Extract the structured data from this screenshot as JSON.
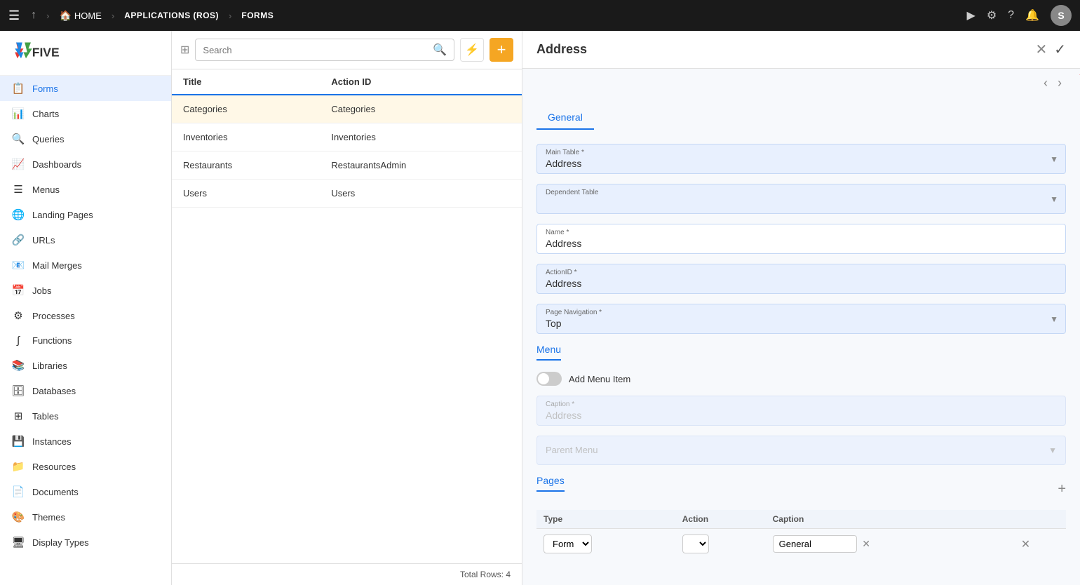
{
  "topNav": {
    "breadcrumbs": [
      "HOME",
      "APPLICATIONS (ROS)",
      "FORMS"
    ],
    "avatarInitial": "S"
  },
  "sidebar": {
    "logo": "FIVE",
    "items": [
      {
        "label": "Forms",
        "icon": "📋",
        "active": true
      },
      {
        "label": "Charts",
        "icon": "📊",
        "active": false
      },
      {
        "label": "Queries",
        "icon": "🔍",
        "active": false
      },
      {
        "label": "Dashboards",
        "icon": "📈",
        "active": false
      },
      {
        "label": "Menus",
        "icon": "☰",
        "active": false
      },
      {
        "label": "Landing Pages",
        "icon": "🌐",
        "active": false
      },
      {
        "label": "URLs",
        "icon": "🔗",
        "active": false
      },
      {
        "label": "Mail Merges",
        "icon": "📧",
        "active": false
      },
      {
        "label": "Jobs",
        "icon": "📅",
        "active": false
      },
      {
        "label": "Processes",
        "icon": "⚙",
        "active": false
      },
      {
        "label": "Functions",
        "icon": "∫",
        "active": false
      },
      {
        "label": "Libraries",
        "icon": "📚",
        "active": false
      },
      {
        "label": "Databases",
        "icon": "🗄",
        "active": false
      },
      {
        "label": "Tables",
        "icon": "⊞",
        "active": false
      },
      {
        "label": "Instances",
        "icon": "💾",
        "active": false
      },
      {
        "label": "Resources",
        "icon": "📁",
        "active": false
      },
      {
        "label": "Documents",
        "icon": "📄",
        "active": false
      },
      {
        "label": "Themes",
        "icon": "🎨",
        "active": false
      },
      {
        "label": "Display Types",
        "icon": "🖥",
        "active": false
      }
    ]
  },
  "listPanel": {
    "searchPlaceholder": "Search",
    "columns": [
      {
        "key": "title",
        "label": "Title"
      },
      {
        "key": "actionId",
        "label": "Action ID"
      }
    ],
    "rows": [
      {
        "title": "Categories",
        "actionId": "Categories",
        "selected": true
      },
      {
        "title": "Inventories",
        "actionId": "Inventories",
        "selected": false
      },
      {
        "title": "Restaurants",
        "actionId": "RestaurantsAdmin",
        "selected": false
      },
      {
        "title": "Users",
        "actionId": "Users",
        "selected": false
      }
    ],
    "footer": "Total Rows: 4"
  },
  "detailPanel": {
    "title": "Address",
    "tabs": [
      "General",
      "Menu",
      "Pages"
    ],
    "activeTab": "General",
    "general": {
      "mainTableLabel": "Main Table *",
      "mainTableValue": "Address",
      "dependentTableLabel": "Dependent Table",
      "dependentTableValue": "",
      "nameLabel": "Name *",
      "nameValue": "Address",
      "actionIdLabel": "ActionID *",
      "actionIdValue": "Address",
      "pageNavigationLabel": "Page Navigation *",
      "pageNavigationValue": "Top"
    },
    "menu": {
      "sectionLabel": "Menu",
      "addMenuItemLabel": "Add Menu Item",
      "captionLabel": "Caption *",
      "captionValue": "Address",
      "parentMenuLabel": "Parent Menu"
    },
    "pages": {
      "sectionLabel": "Pages",
      "columns": [
        "Type",
        "Action",
        "Caption"
      ],
      "rows": [
        {
          "type": "Form",
          "action": "",
          "caption": "General"
        }
      ]
    }
  }
}
